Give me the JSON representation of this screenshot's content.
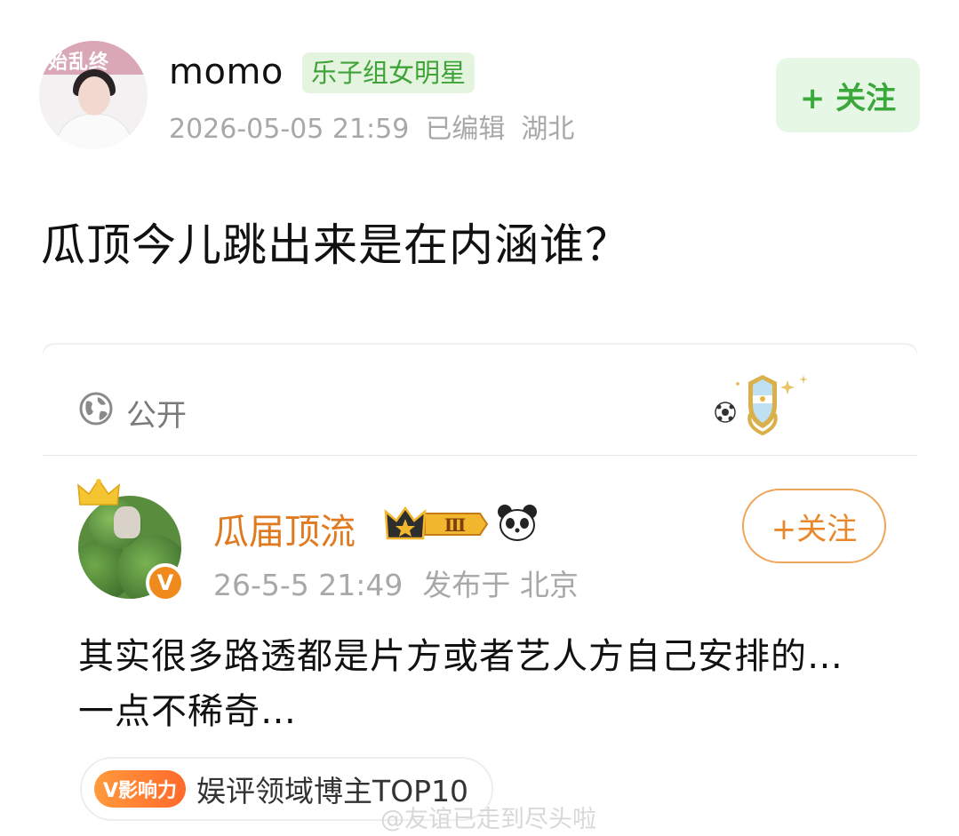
{
  "post": {
    "avatar_band_text": "始乱终",
    "username": "momo",
    "tag": "乐子组女明星",
    "timestamp": "2026-05-05 21:59",
    "edited": "已编辑",
    "location": "湖北",
    "follow_label": "+ 关注",
    "text": "瓜顶今儿跳出来是在内涵谁？"
  },
  "card": {
    "visibility": "公开",
    "author": {
      "name": "瓜届顶流",
      "level": "Ⅲ",
      "timestamp": "26-5-5 21:49",
      "published_at": "发布于 北京",
      "verified_mark": "V",
      "follow_label": "+关注"
    },
    "comment": "其实很多路透都是片方或者艺人方自己安排的…一点不稀奇…",
    "influence": {
      "badge": "V影响力",
      "label": "娱评领域博主TOP10"
    }
  },
  "watermark": "@友谊已走到尽头啦",
  "colors": {
    "green_accent": "#3fa33a",
    "orange_accent": "#e07a1f",
    "meta_gray": "#a8a8a8"
  },
  "icons": [
    "globe-icon",
    "crown-icon",
    "level-badge-icon",
    "panda-icon",
    "verified-v-icon",
    "football-icon",
    "shield-badge-icon"
  ]
}
